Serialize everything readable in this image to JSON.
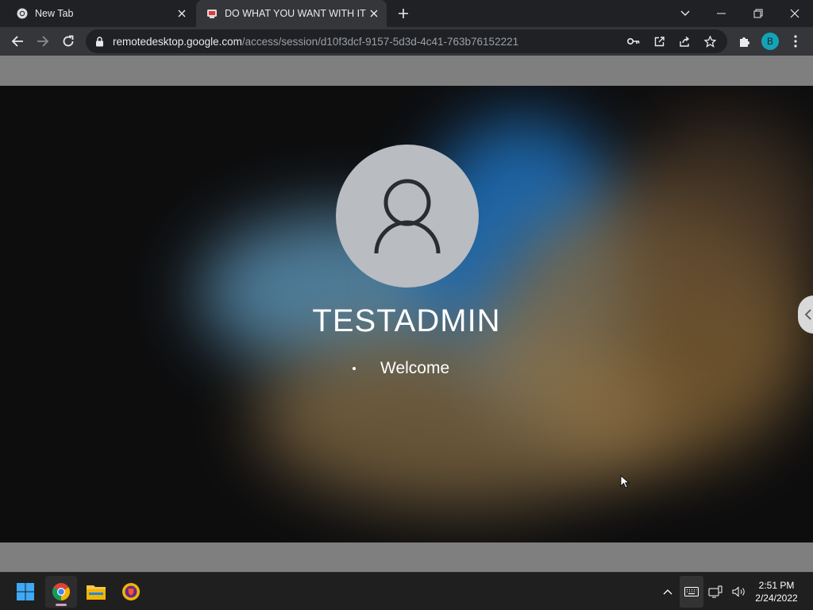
{
  "browser": {
    "tabs": [
      {
        "title": "New Tab",
        "favicon": "chrome-icon",
        "active": false
      },
      {
        "title": "DO WHAT YOU WANT WITH IT BUT D",
        "favicon": "remote-desktop-icon",
        "active": true
      }
    ],
    "url_host": "remotedesktop.google.com",
    "url_path": "/access/session/d10f3dcf-9157-5d3d-4c41-763b76152221",
    "profile_initial": "B",
    "accent_color": "#12a4b6"
  },
  "remote": {
    "username": "TESTADMIN",
    "status": "Welcome"
  },
  "taskbar": {
    "apps": [
      "start-icon",
      "chrome-icon",
      "file-explorer-icon",
      "brave-icon"
    ],
    "clock_time": "2:51 PM",
    "clock_date": "2/24/2022"
  }
}
